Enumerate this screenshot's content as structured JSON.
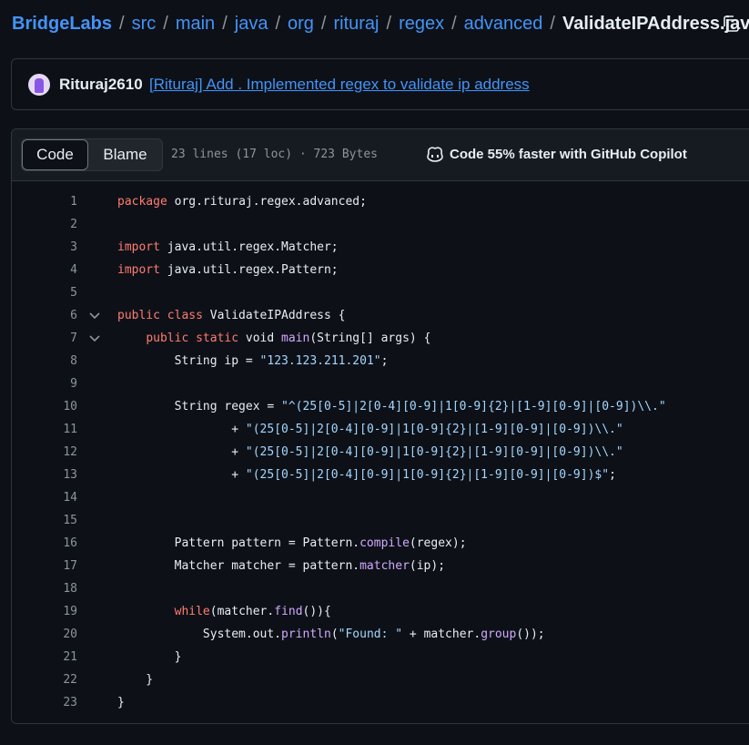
{
  "breadcrumb": {
    "items": [
      "BridgeLabs",
      "src",
      "main",
      "java",
      "org",
      "rituraj",
      "regex",
      "advanced"
    ],
    "separator": "/",
    "current": "ValidateIPAddress.java"
  },
  "commit": {
    "author": "Rituraj2610",
    "message": "[Rituraj] Add . Implemented regex to validate ip address"
  },
  "file_header": {
    "code_tab": "Code",
    "blame_tab": "Blame",
    "meta": "23 lines (17 loc) · 723 Bytes",
    "copilot_label": "Code 55% faster with GitHub Copilot"
  },
  "icons": {
    "copy": "copy-icon",
    "avatar": "avatar",
    "copilot": "copilot-icon",
    "fold": "chevron-down-icon"
  },
  "colors": {
    "background": "#0d1117",
    "link": "#4493f8",
    "keyword": "#ff7b72",
    "string": "#a5d6ff",
    "function": "#d2a8ff",
    "line_number": "#8b949e"
  },
  "code": {
    "lines": [
      {
        "n": "1",
        "fold": false,
        "tokens": [
          [
            "kw",
            "package"
          ],
          [
            "",
            "&nbsp;org.rituraj.regex.advanced;"
          ]
        ]
      },
      {
        "n": "2",
        "fold": false,
        "tokens": []
      },
      {
        "n": "3",
        "fold": false,
        "tokens": [
          [
            "kw",
            "import"
          ],
          [
            "",
            "&nbsp;java.util.regex.Matcher;"
          ]
        ]
      },
      {
        "n": "4",
        "fold": false,
        "tokens": [
          [
            "kw",
            "import"
          ],
          [
            "",
            "&nbsp;java.util.regex.Pattern;"
          ]
        ]
      },
      {
        "n": "5",
        "fold": false,
        "tokens": []
      },
      {
        "n": "6",
        "fold": true,
        "tokens": [
          [
            "kw",
            "public class"
          ],
          [
            "",
            "&nbsp;ValidateIPAddress {"
          ]
        ]
      },
      {
        "n": "7",
        "fold": true,
        "tokens": [
          [
            "",
            "    "
          ],
          [
            "kw",
            "public static"
          ],
          [
            "",
            "&nbsp;void&nbsp;"
          ],
          [
            "fn",
            "main"
          ],
          [
            "",
            "(String[] args) {"
          ]
        ]
      },
      {
        "n": "8",
        "fold": false,
        "tokens": [
          [
            "",
            "        String ip = "
          ],
          [
            "str",
            "\"123.123.211.201\""
          ],
          [
            "",
            ";"
          ]
        ]
      },
      {
        "n": "9",
        "fold": false,
        "tokens": []
      },
      {
        "n": "10",
        "fold": false,
        "tokens": [
          [
            "",
            "        String regex = "
          ],
          [
            "str",
            "\"^(25[0-5]|2[0-4][0-9]|1[0-9]{2}|[1-9][0-9]|[0-9])\\\\.\""
          ]
        ]
      },
      {
        "n": "11",
        "fold": false,
        "tokens": [
          [
            "",
            "                + "
          ],
          [
            "str",
            "\"(25[0-5]|2[0-4][0-9]|1[0-9]{2}|[1-9][0-9]|[0-9])\\\\.\""
          ]
        ]
      },
      {
        "n": "12",
        "fold": false,
        "tokens": [
          [
            "",
            "                + "
          ],
          [
            "str",
            "\"(25[0-5]|2[0-4][0-9]|1[0-9]{2}|[1-9][0-9]|[0-9])\\\\.\""
          ]
        ]
      },
      {
        "n": "13",
        "fold": false,
        "tokens": [
          [
            "",
            "                + "
          ],
          [
            "str",
            "\"(25[0-5]|2[0-4][0-9]|1[0-9]{2}|[1-9][0-9]|[0-9])$\""
          ],
          [
            "",
            ";"
          ]
        ]
      },
      {
        "n": "14",
        "fold": false,
        "tokens": []
      },
      {
        "n": "15",
        "fold": false,
        "tokens": []
      },
      {
        "n": "16",
        "fold": false,
        "tokens": [
          [
            "",
            "        Pattern pattern = Pattern."
          ],
          [
            "fn",
            "compile"
          ],
          [
            "",
            "(regex);"
          ]
        ]
      },
      {
        "n": "17",
        "fold": false,
        "tokens": [
          [
            "",
            "        Matcher matcher = pattern."
          ],
          [
            "fn",
            "matcher"
          ],
          [
            "",
            "(ip);"
          ]
        ]
      },
      {
        "n": "18",
        "fold": false,
        "tokens": []
      },
      {
        "n": "19",
        "fold": false,
        "tokens": [
          [
            "",
            "        "
          ],
          [
            "kw",
            "while"
          ],
          [
            "",
            "(matcher."
          ],
          [
            "fn",
            "find"
          ],
          [
            "",
            "()){"
          ]
        ]
      },
      {
        "n": "20",
        "fold": false,
        "tokens": [
          [
            "",
            "            System.out."
          ],
          [
            "fn",
            "println"
          ],
          [
            "",
            "("
          ],
          [
            "str",
            "\"Found: \""
          ],
          [
            "",
            " + matcher."
          ],
          [
            "fn",
            "group"
          ],
          [
            "",
            "());"
          ]
        ]
      },
      {
        "n": "21",
        "fold": false,
        "tokens": [
          [
            "",
            "        }"
          ]
        ]
      },
      {
        "n": "22",
        "fold": false,
        "tokens": [
          [
            "",
            "    }"
          ]
        ]
      },
      {
        "n": "23",
        "fold": false,
        "tokens": [
          [
            "",
            "}"
          ]
        ]
      }
    ]
  }
}
